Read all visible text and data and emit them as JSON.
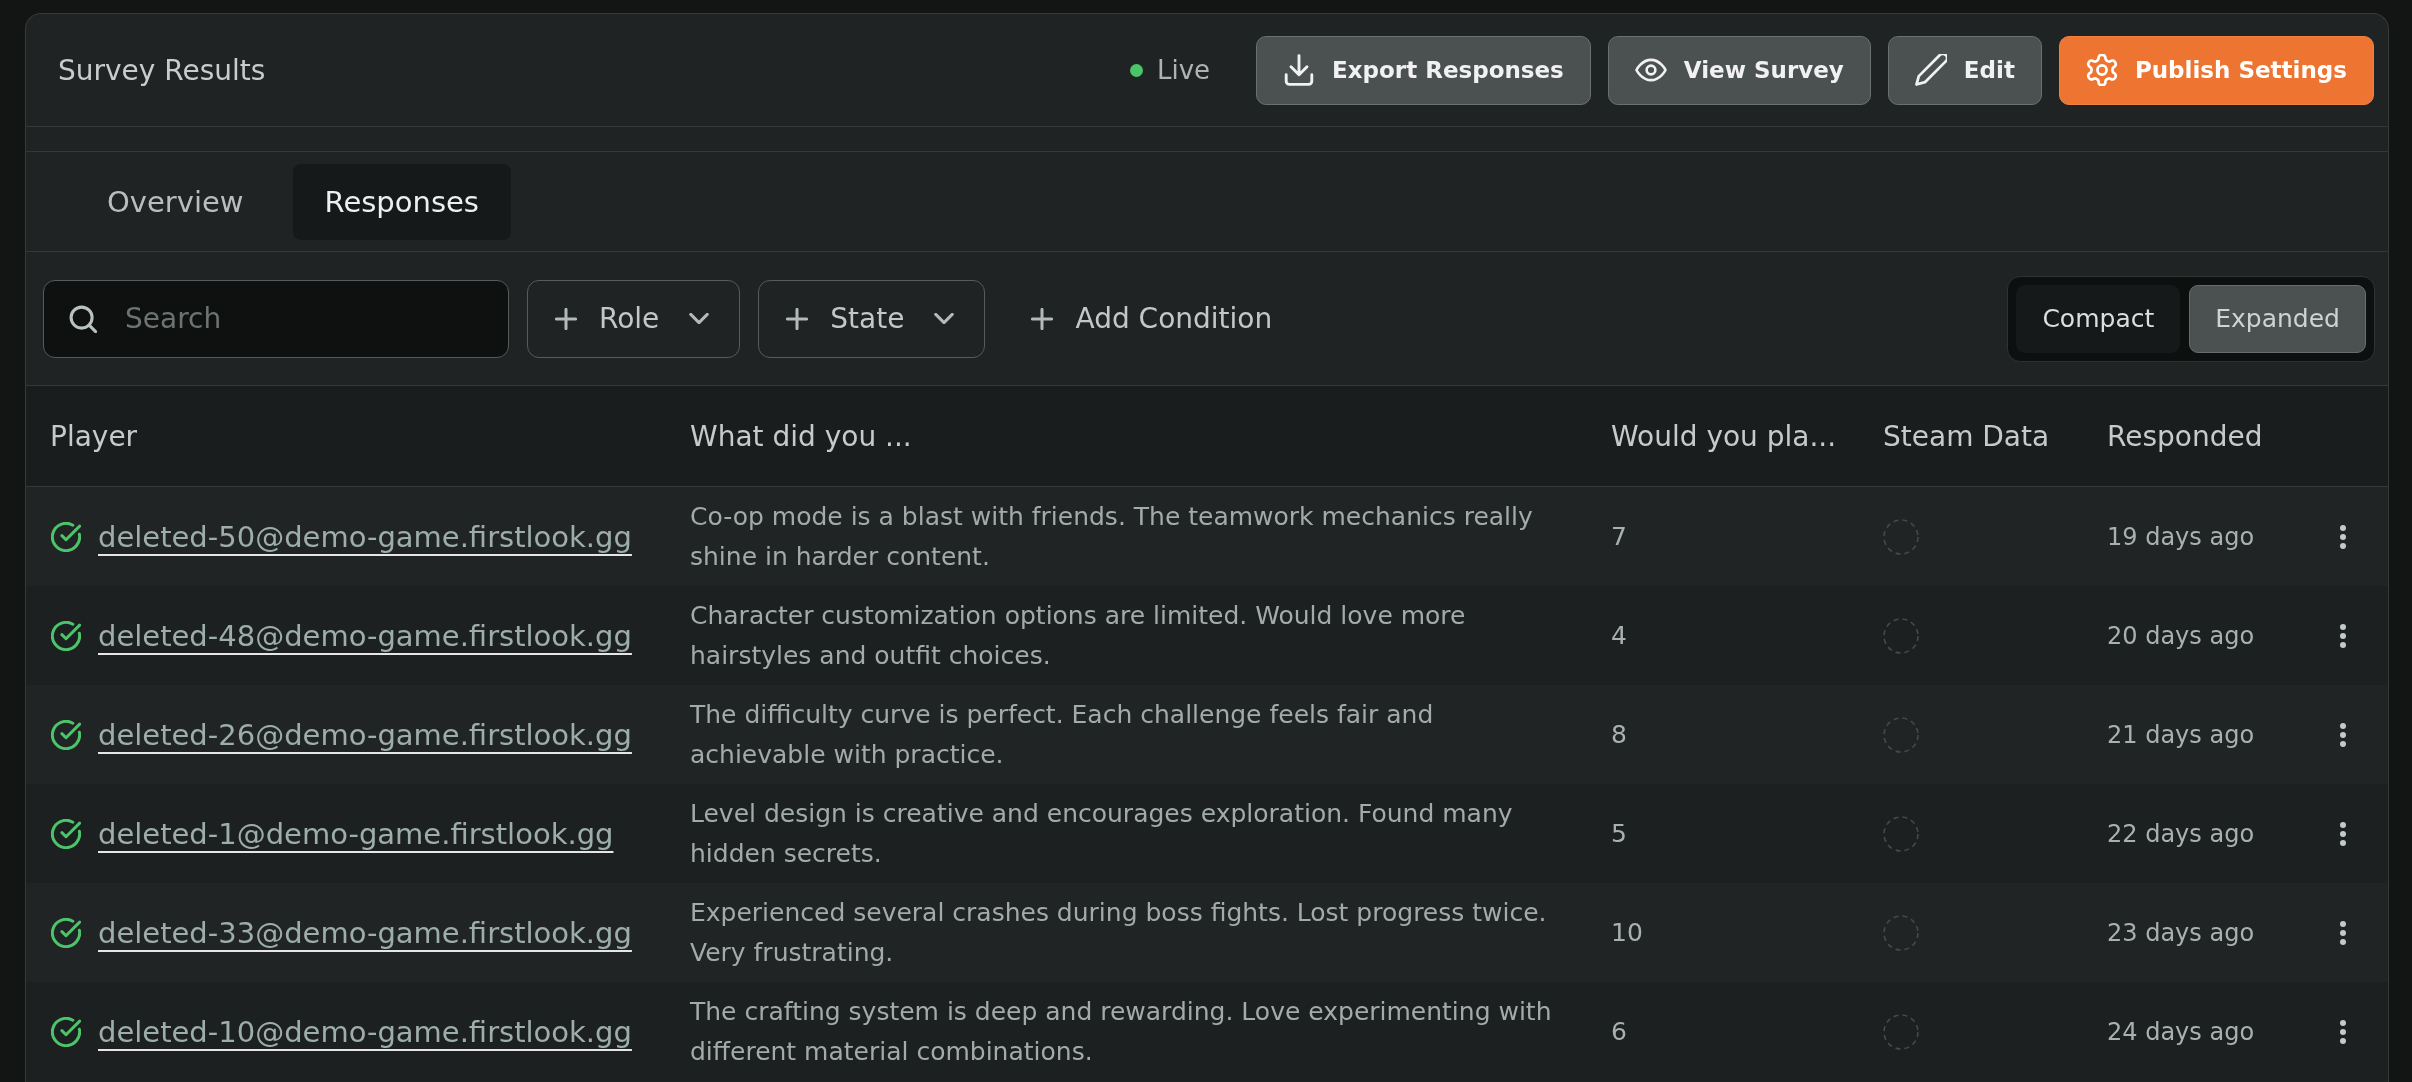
{
  "header": {
    "title": "Survey Results",
    "status": {
      "label": "Live"
    },
    "actions": [
      {
        "label": "Export Responses",
        "kind": "secondary"
      },
      {
        "label": "View Survey",
        "kind": "secondary"
      },
      {
        "label": "Edit",
        "kind": "secondary"
      },
      {
        "label": "Publish Settings",
        "kind": "primary"
      }
    ]
  },
  "tabs": [
    {
      "label": "Overview",
      "selected": false
    },
    {
      "label": "Responses",
      "selected": true
    }
  ],
  "filters": {
    "search": {
      "placeholder": "Search"
    },
    "dropdowns": [
      {
        "label": "Role"
      },
      {
        "label": "State"
      }
    ],
    "add_condition": {
      "label": "Add Condition"
    },
    "view_toggle": [
      {
        "label": "Compact",
        "selected": false
      },
      {
        "label": "Expanded",
        "selected": true
      }
    ]
  },
  "table": {
    "columns": [
      "Player",
      "What did you ...",
      "Would you pla...",
      "Steam Data",
      "Responded"
    ],
    "rows": [
      {
        "player": "deleted-50@demo-game.firstlook.gg",
        "verified": true,
        "column_2": "Co-op mode is a blast with friends. The teamwork mechanics really shine in harder content.",
        "column_3": "7",
        "responded": "19 days ago"
      },
      {
        "player": "deleted-48@demo-game.firstlook.gg",
        "verified": true,
        "column_2": "Character customization options are limited. Would love more hairstyles and outfit choices.",
        "column_3": "4",
        "responded": "20 days ago"
      },
      {
        "player": "deleted-26@demo-game.firstlook.gg",
        "verified": true,
        "column_2": "The difficulty curve is perfect. Each challenge feels fair and achievable with practice.",
        "column_3": "8",
        "responded": "21 days ago"
      },
      {
        "player": "deleted-1@demo-game.firstlook.gg",
        "verified": true,
        "column_2": "Level design is creative and encourages exploration. Found many hidden secrets.",
        "column_3": "5",
        "responded": "22 days ago"
      },
      {
        "player": "deleted-33@demo-game.firstlook.gg",
        "verified": true,
        "column_2": "Experienced several crashes during boss fights. Lost progress twice. Very frustrating.",
        "column_3": "10",
        "responded": "23 days ago"
      },
      {
        "player": "deleted-10@demo-game.firstlook.gg",
        "verified": true,
        "column_2": "The crafting system is deep and rewarding. Love experimenting with different material combinations.",
        "column_3": "6",
        "responded": "24 days ago"
      }
    ]
  }
}
